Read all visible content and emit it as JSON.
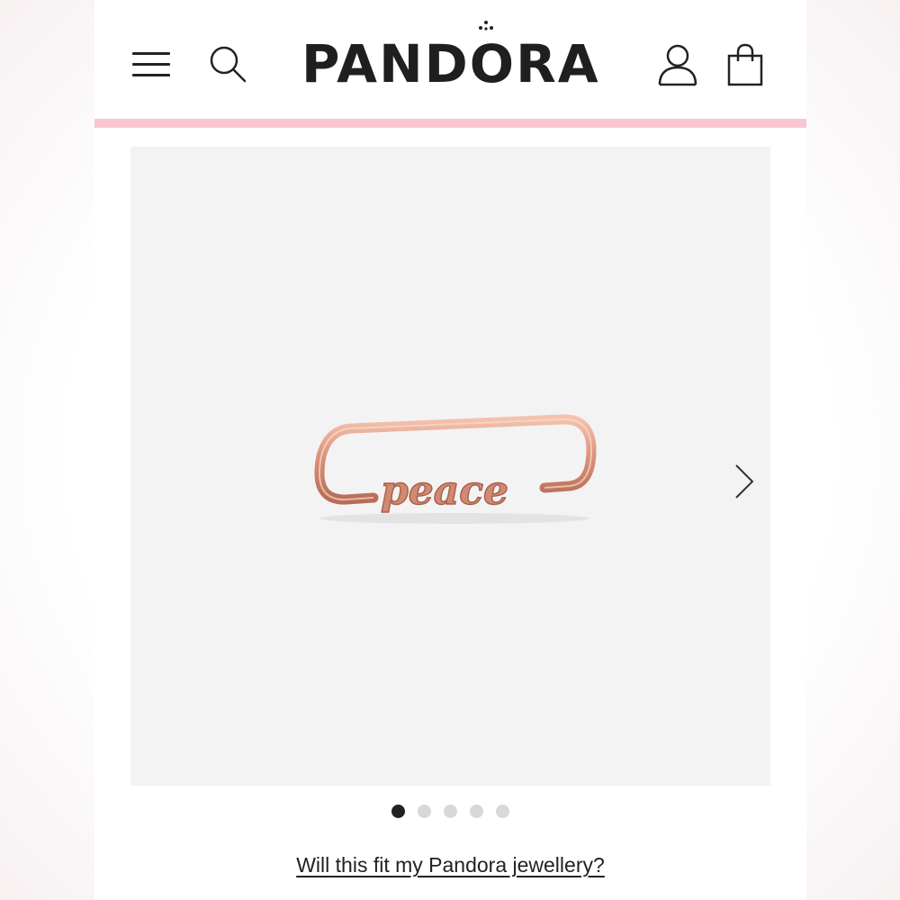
{
  "header": {
    "brand": "PANDORA",
    "icons": [
      "menu-icon",
      "search-icon",
      "crown-icon",
      "account-icon",
      "shopping-bag-icon"
    ],
    "accent_color": "#f8c6cf"
  },
  "product": {
    "engraving": "peace",
    "metal_color": "#d98f76"
  },
  "carousel": {
    "slide_count": 5,
    "active_index": 0
  },
  "fit_link": "Will this fit my Pandora jewellery?"
}
